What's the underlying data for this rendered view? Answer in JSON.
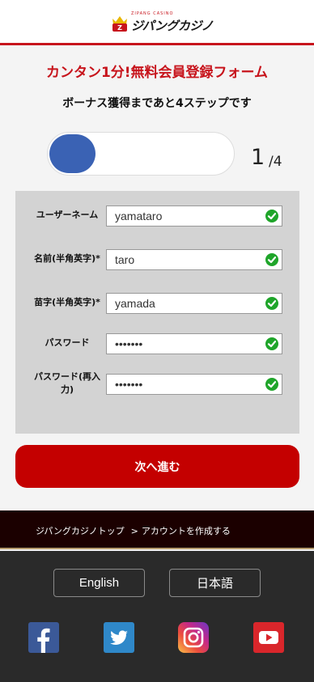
{
  "header": {
    "logo_tagline": "ZIPANG CASINO",
    "logo_text": "ジパングカジノ"
  },
  "form": {
    "title": "カンタン1分!無料会員登録フォーム",
    "subtitle": "ボーナス獲得まであと4ステップです",
    "progress": {
      "current": "1",
      "total": "/4",
      "fraction": 0.25
    },
    "fields": [
      {
        "label": "ユーザーネーム",
        "value": "yamataro"
      },
      {
        "label": "名前(半角英字)*",
        "value": "taro"
      },
      {
        "label": "苗字(半角英字)*",
        "value": "yamada"
      },
      {
        "label": "パスワード",
        "value": "•••••••"
      },
      {
        "label": "パスワード(再入力)",
        "value": "•••••••"
      }
    ],
    "next_label": "次へ進む"
  },
  "breadcrumb": {
    "home": "ジパングカジノトップ",
    "separator": ">",
    "current": "アカウントを作成する"
  },
  "footer": {
    "languages": [
      "English",
      "日本語"
    ],
    "social": [
      "facebook-icon",
      "twitter-icon",
      "instagram-icon",
      "youtube-icon"
    ]
  },
  "colors": {
    "brand_red": "#c7141c",
    "button_red": "#c40000",
    "progress_blue": "#3a62b4",
    "check_green": "#1fa52a"
  }
}
